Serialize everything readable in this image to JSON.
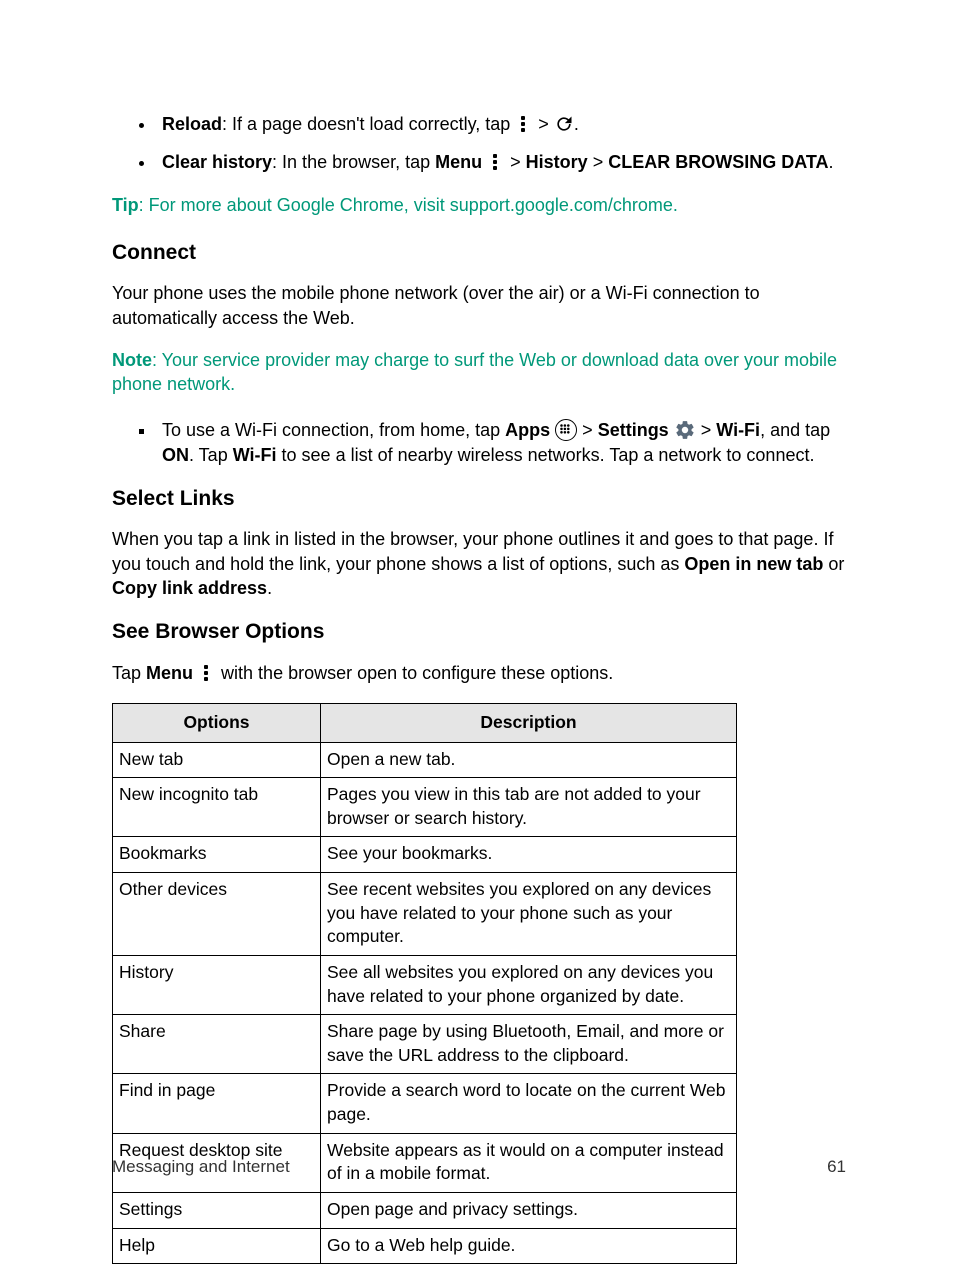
{
  "bullets_top": [
    {
      "strong": "Reload",
      "before": ": If a page doesn't load correctly, tap ",
      "after": "."
    },
    {
      "strong": "Clear history",
      "before": ": In the browser, tap ",
      "menu_label": "Menu",
      "mid": " > ",
      "hist": "History",
      "mid2": " > ",
      "clear": "CLEAR BROWSING DATA",
      "end": "."
    }
  ],
  "tip": {
    "label": "Tip",
    "text": ": For more about Google Chrome, visit ",
    "link": "support.google.com/chrome",
    "end": "."
  },
  "connect": {
    "heading": "Connect",
    "p1": "Your phone uses the mobile phone network (over the air) or a Wi-Fi connection to automatically access the Web.",
    "note_label": "Note",
    "note_text": ": Your service provider may charge to surf the Web or download data over your mobile phone network.",
    "li_pre": "To use a Wi-Fi connection, from home, tap ",
    "apps": "Apps",
    "gt1": " > ",
    "settings": "Settings",
    "gt2": " > ",
    "wifi": "Wi-Fi",
    "mid": ", and tap ",
    "on": "ON",
    "after_on": ". Tap ",
    "wifi2": "Wi-Fi",
    "tail": " to see a list of nearby wireless networks. Tap a network to connect."
  },
  "select_links": {
    "heading": "Select Links",
    "p_pre": "When you tap a link in listed in the browser, your phone outlines it and goes to that page. If you touch and hold the link, your phone shows a list of options, such as ",
    "opt1": "Open in new tab",
    "or": " or ",
    "opt2": "Copy link address",
    "end": "."
  },
  "browser_options": {
    "heading": "See Browser Options",
    "intro_pre": "Tap ",
    "menu": "Menu",
    "intro_post": " with the browser open to configure these options.",
    "col1": "Options",
    "col2": "Description",
    "rows": [
      {
        "opt": "New tab",
        "desc": "Open a new tab."
      },
      {
        "opt": "New incognito tab",
        "desc": "Pages you view in this tab are not added to your browser or search history."
      },
      {
        "opt": "Bookmarks",
        "desc": "See your bookmarks."
      },
      {
        "opt": "Other devices",
        "desc": "See recent websites you explored on any devices you have related to your phone such as your computer."
      },
      {
        "opt": "History",
        "desc": "See all websites you explored on any devices you have related to your phone organized by date."
      },
      {
        "opt": "Share",
        "desc": "Share page by using Bluetooth, Email, and more or save the URL address to the clipboard."
      },
      {
        "opt": "Find in page",
        "desc": "Provide a search word to locate on the current Web page."
      },
      {
        "opt": "Request desktop site",
        "desc": "Website appears as it would on a computer instead of in a mobile format."
      },
      {
        "opt": "Settings",
        "desc": "Open page and privacy settings."
      },
      {
        "opt": "Help",
        "desc": "Go to a Web help guide."
      }
    ]
  },
  "footer": {
    "section": "Messaging and Internet",
    "page": "61"
  }
}
